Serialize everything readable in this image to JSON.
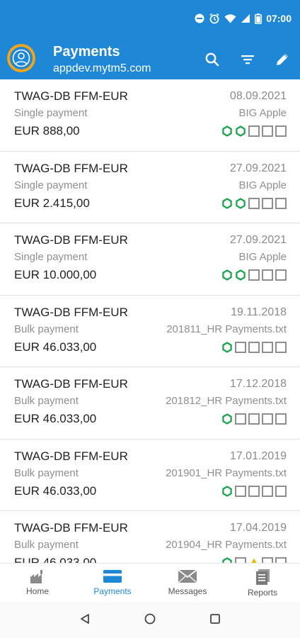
{
  "status_bar": {
    "time": "07:00"
  },
  "header": {
    "title": "Payments",
    "subtitle": "appdev.mytm5.com"
  },
  "payments": [
    {
      "bank": "TWAG-DB FFM-EUR",
      "date": "08.09.2021",
      "type": "Single payment",
      "reference": "BIG Apple",
      "amount": "EUR 888,00",
      "signatures": [
        "done",
        "done",
        "empty",
        "empty",
        "empty"
      ]
    },
    {
      "bank": "TWAG-DB FFM-EUR",
      "date": "27.09.2021",
      "type": "Single payment",
      "reference": "BIG Apple",
      "amount": "EUR 2.415,00",
      "signatures": [
        "done",
        "done",
        "empty",
        "empty",
        "empty"
      ]
    },
    {
      "bank": "TWAG-DB FFM-EUR",
      "date": "27.09.2021",
      "type": "Single payment",
      "reference": "BIG Apple",
      "amount": "EUR 10.000,00",
      "signatures": [
        "done",
        "done",
        "empty",
        "empty",
        "empty"
      ]
    },
    {
      "bank": "TWAG-DB FFM-EUR",
      "date": "19.11.2018",
      "type": "Bulk payment",
      "reference": "201811_HR Payments.txt",
      "amount": "EUR 46.033,00",
      "signatures": [
        "done",
        "empty",
        "empty",
        "empty",
        "empty"
      ]
    },
    {
      "bank": "TWAG-DB FFM-EUR",
      "date": "17.12.2018",
      "type": "Bulk payment",
      "reference": "201812_HR Payments.txt",
      "amount": "EUR 46.033,00",
      "signatures": [
        "done",
        "empty",
        "empty",
        "empty",
        "empty"
      ]
    },
    {
      "bank": "TWAG-DB FFM-EUR",
      "date": "17.01.2019",
      "type": "Bulk payment",
      "reference": "201901_HR Payments.txt",
      "amount": "EUR 46.033,00",
      "signatures": [
        "done",
        "empty",
        "empty",
        "empty",
        "empty"
      ]
    },
    {
      "bank": "TWAG-DB FFM-EUR",
      "date": "17.04.2019",
      "type": "Bulk payment",
      "reference": "201904_HR Payments.txt",
      "amount": "EUR 46.033,00",
      "signatures": [
        "done",
        "empty",
        "warning",
        "empty",
        "empty"
      ]
    }
  ],
  "bottom_nav": [
    {
      "label": "Home",
      "icon": "home-icon",
      "active": false
    },
    {
      "label": "Payments",
      "icon": "payments-card-icon",
      "active": true
    },
    {
      "label": "Messages",
      "icon": "envelope-icon",
      "active": false
    },
    {
      "label": "Reports",
      "icon": "document-icon",
      "active": false
    }
  ],
  "colors": {
    "accent": "#1e88d6",
    "avatar_ring": "#f2a41a",
    "signature_done": "#16a34a",
    "signature_warning": "#f5b400"
  }
}
